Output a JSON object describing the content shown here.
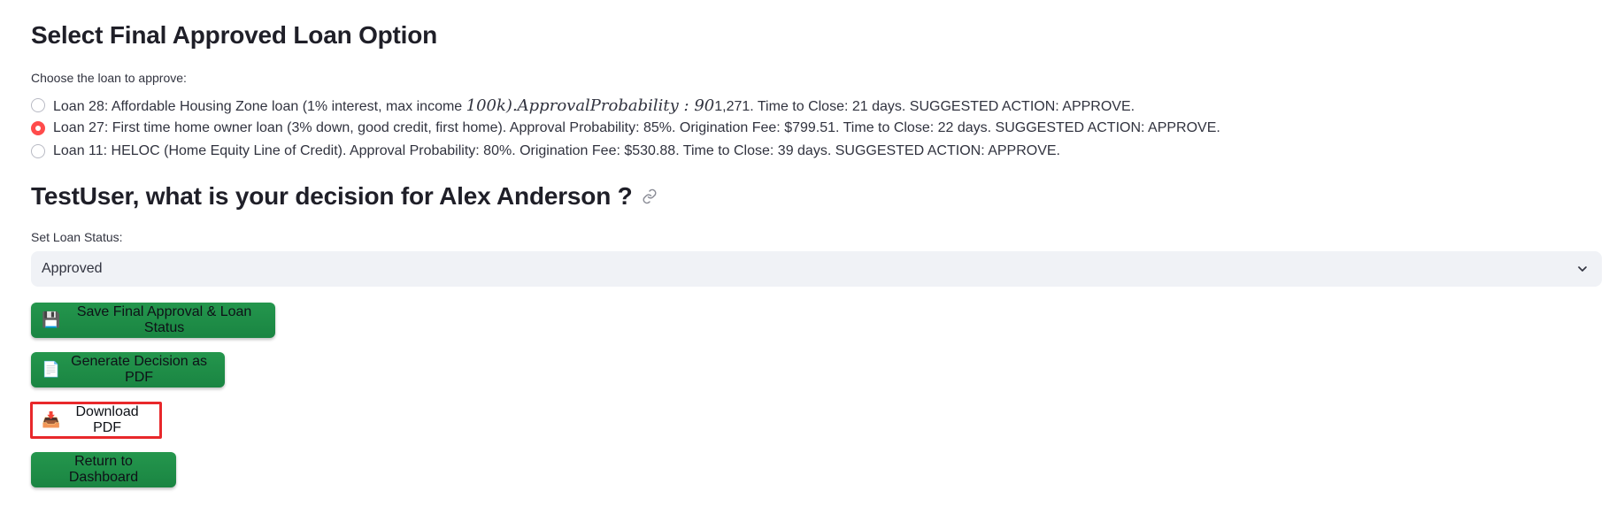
{
  "section1": {
    "title": "Select Final Approved Loan Option",
    "radio_label": "Choose the loan to approve:",
    "options": [
      {
        "text_before": "Loan 28: Affordable Housing Zone loan (1% interest, max income ",
        "math": "100k).ApprovalProbability : 90",
        "text_after": "1,271. Time to Close: 21 days. SUGGESTED ACTION: APPROVE.",
        "selected": false
      },
      {
        "text": "Loan 27: First time home owner loan (3% down, good credit, first home). Approval Probability: 85%. Origination Fee: $799.51. Time to Close: 22 days. SUGGESTED ACTION: APPROVE.",
        "selected": true
      },
      {
        "text": "Loan 11: HELOC (Home Equity Line of Credit). Approval Probability: 80%. Origination Fee: $530.88. Time to Close: 39 days. SUGGESTED ACTION: APPROVE.",
        "selected": false
      }
    ]
  },
  "section2": {
    "title": "TestUser, what is your decision for Alex Anderson ?",
    "status_label": "Set Loan Status:",
    "status_value": "Approved"
  },
  "buttons": {
    "save": {
      "emoji": "💾",
      "label": "Save Final Approval & Loan Status"
    },
    "generate": {
      "emoji": "📄",
      "label": "Generate Decision as PDF"
    },
    "download": {
      "emoji": "📥",
      "label": "Download PDF"
    },
    "return": {
      "label": "Return to Dashboard"
    }
  },
  "colors": {
    "accent_radio": "#ff4b4b",
    "button_green": "#1e8d47",
    "highlight_border": "#e8282b",
    "select_bg": "#f0f2f6"
  },
  "icons": {
    "anchor": "link-icon",
    "select": "chevron-down-icon"
  }
}
